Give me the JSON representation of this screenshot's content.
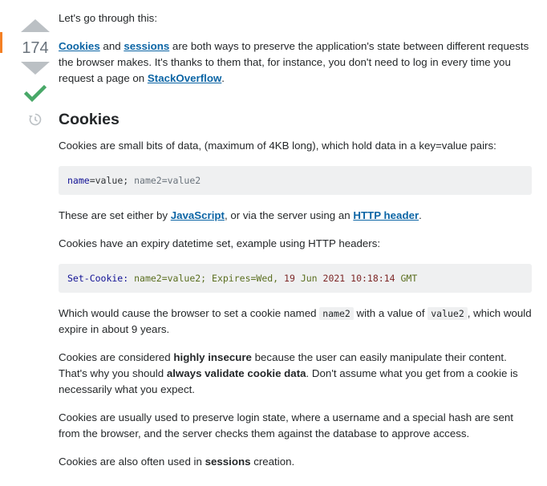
{
  "votes": {
    "count": "174",
    "accepted": true
  },
  "answer": {
    "intro": "Let's go through this:",
    "p1": {
      "link1": "Cookies",
      "and": " and ",
      "link2": "sessions",
      "text": " are both ways to preserve the application's state between different requests the browser makes. It's thanks to them that, for instance, you don't need to log in every time you request a page on ",
      "link3": "StackOverflow",
      "end": "."
    },
    "heading": "Cookies",
    "p2": "Cookies are small bits of data, (maximum of 4KB long), which hold data in a key=value pairs:",
    "code1": {
      "key1": "name",
      "eq1": "=value; ",
      "rest": "name2=value2"
    },
    "p3": {
      "pre": "These are set either by ",
      "link1": "JavaScript",
      "mid": ", or via the server using an ",
      "link2": "HTTP header",
      "end": "."
    },
    "p4": "Cookies have an expiry datetime set, example using HTTP headers:",
    "code2": {
      "header": "Set-Cookie:",
      "kv": " name2=value2; Expires=Wed, ",
      "num1": "19",
      "mid": " Jun ",
      "num2": "2021 10:18:14",
      "tz": " GMT"
    },
    "p5": {
      "pre": "Which would cause the browser to set a cookie named ",
      "code1": "name2",
      "mid": " with a value of ",
      "code2": "value2",
      "end": ", which would expire in about 9 years."
    },
    "p6": {
      "pre": "Cookies are considered ",
      "strong1": "highly insecure",
      "mid": " because the user can easily manipulate their content. That's why you should ",
      "strong2": "always validate cookie data",
      "end": ". Don't assume what you get from a cookie is necessarily what you expect."
    },
    "p7": "Cookies are usually used to preserve login state, where a username and a special hash are sent from the browser, and the server checks them against the database to approve access.",
    "p8": {
      "pre": "Cookies are also often used in ",
      "strong": "sessions",
      "end": " creation."
    }
  },
  "colors": {
    "link": "#0c65a5",
    "accepted": "#48a868",
    "vote_arrow": "#bbc0c4",
    "accent": "#f48024"
  }
}
